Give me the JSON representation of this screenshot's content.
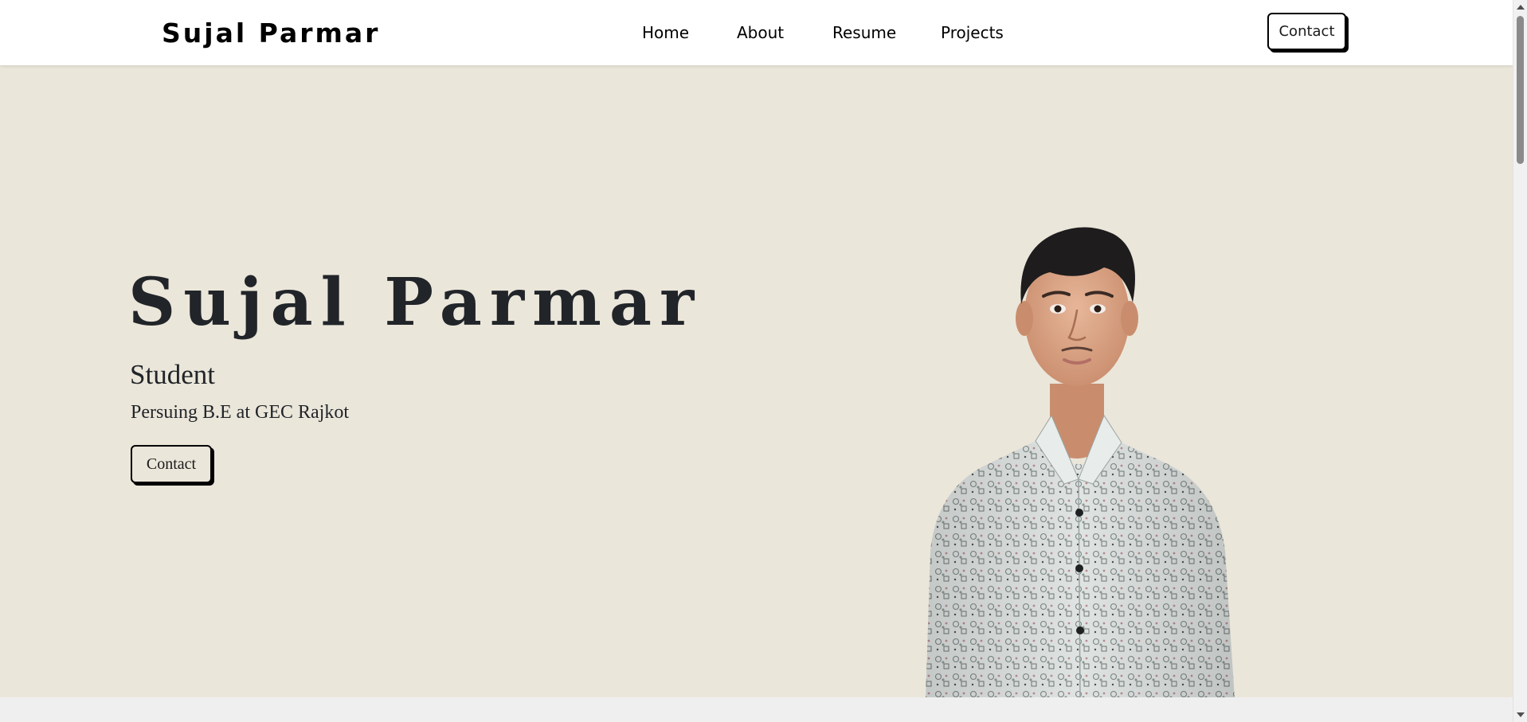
{
  "header": {
    "brand": "Sujal Parmar",
    "nav": [
      {
        "label": "Home"
      },
      {
        "label": "About"
      },
      {
        "label": "Resume"
      },
      {
        "label": "Projects"
      }
    ],
    "contact_label": "Contact"
  },
  "hero": {
    "title": "Sujal Parmar",
    "role": "Student",
    "description": "Persuing B.E at GEC Rajkot",
    "contact_label": "Contact",
    "portrait_icon": "person-portrait-icon"
  },
  "colors": {
    "header_bg": "#ffffff",
    "hero_bg": "#ebe6da",
    "text": "#212529",
    "button_border": "#000000",
    "page_bg": "#efefef"
  }
}
